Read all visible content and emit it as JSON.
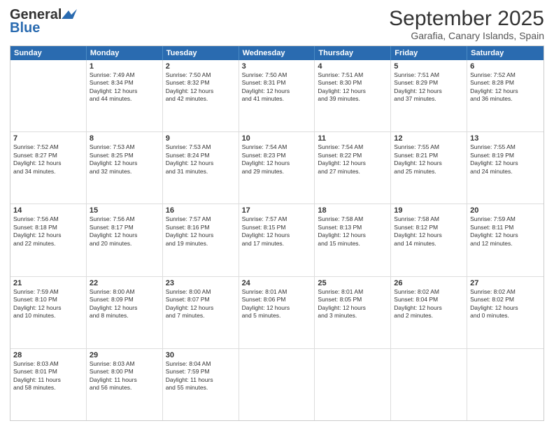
{
  "header": {
    "logo_general": "General",
    "logo_blue": "Blue",
    "title": "September 2025",
    "subtitle": "Garafia, Canary Islands, Spain"
  },
  "days_of_week": [
    "Sunday",
    "Monday",
    "Tuesday",
    "Wednesday",
    "Thursday",
    "Friday",
    "Saturday"
  ],
  "weeks": [
    [
      {
        "day": "",
        "info": ""
      },
      {
        "day": "1",
        "info": "Sunrise: 7:49 AM\nSunset: 8:34 PM\nDaylight: 12 hours\nand 44 minutes."
      },
      {
        "day": "2",
        "info": "Sunrise: 7:50 AM\nSunset: 8:32 PM\nDaylight: 12 hours\nand 42 minutes."
      },
      {
        "day": "3",
        "info": "Sunrise: 7:50 AM\nSunset: 8:31 PM\nDaylight: 12 hours\nand 41 minutes."
      },
      {
        "day": "4",
        "info": "Sunrise: 7:51 AM\nSunset: 8:30 PM\nDaylight: 12 hours\nand 39 minutes."
      },
      {
        "day": "5",
        "info": "Sunrise: 7:51 AM\nSunset: 8:29 PM\nDaylight: 12 hours\nand 37 minutes."
      },
      {
        "day": "6",
        "info": "Sunrise: 7:52 AM\nSunset: 8:28 PM\nDaylight: 12 hours\nand 36 minutes."
      }
    ],
    [
      {
        "day": "7",
        "info": "Sunrise: 7:52 AM\nSunset: 8:27 PM\nDaylight: 12 hours\nand 34 minutes."
      },
      {
        "day": "8",
        "info": "Sunrise: 7:53 AM\nSunset: 8:25 PM\nDaylight: 12 hours\nand 32 minutes."
      },
      {
        "day": "9",
        "info": "Sunrise: 7:53 AM\nSunset: 8:24 PM\nDaylight: 12 hours\nand 31 minutes."
      },
      {
        "day": "10",
        "info": "Sunrise: 7:54 AM\nSunset: 8:23 PM\nDaylight: 12 hours\nand 29 minutes."
      },
      {
        "day": "11",
        "info": "Sunrise: 7:54 AM\nSunset: 8:22 PM\nDaylight: 12 hours\nand 27 minutes."
      },
      {
        "day": "12",
        "info": "Sunrise: 7:55 AM\nSunset: 8:21 PM\nDaylight: 12 hours\nand 25 minutes."
      },
      {
        "day": "13",
        "info": "Sunrise: 7:55 AM\nSunset: 8:19 PM\nDaylight: 12 hours\nand 24 minutes."
      }
    ],
    [
      {
        "day": "14",
        "info": "Sunrise: 7:56 AM\nSunset: 8:18 PM\nDaylight: 12 hours\nand 22 minutes."
      },
      {
        "day": "15",
        "info": "Sunrise: 7:56 AM\nSunset: 8:17 PM\nDaylight: 12 hours\nand 20 minutes."
      },
      {
        "day": "16",
        "info": "Sunrise: 7:57 AM\nSunset: 8:16 PM\nDaylight: 12 hours\nand 19 minutes."
      },
      {
        "day": "17",
        "info": "Sunrise: 7:57 AM\nSunset: 8:15 PM\nDaylight: 12 hours\nand 17 minutes."
      },
      {
        "day": "18",
        "info": "Sunrise: 7:58 AM\nSunset: 8:13 PM\nDaylight: 12 hours\nand 15 minutes."
      },
      {
        "day": "19",
        "info": "Sunrise: 7:58 AM\nSunset: 8:12 PM\nDaylight: 12 hours\nand 14 minutes."
      },
      {
        "day": "20",
        "info": "Sunrise: 7:59 AM\nSunset: 8:11 PM\nDaylight: 12 hours\nand 12 minutes."
      }
    ],
    [
      {
        "day": "21",
        "info": "Sunrise: 7:59 AM\nSunset: 8:10 PM\nDaylight: 12 hours\nand 10 minutes."
      },
      {
        "day": "22",
        "info": "Sunrise: 8:00 AM\nSunset: 8:09 PM\nDaylight: 12 hours\nand 8 minutes."
      },
      {
        "day": "23",
        "info": "Sunrise: 8:00 AM\nSunset: 8:07 PM\nDaylight: 12 hours\nand 7 minutes."
      },
      {
        "day": "24",
        "info": "Sunrise: 8:01 AM\nSunset: 8:06 PM\nDaylight: 12 hours\nand 5 minutes."
      },
      {
        "day": "25",
        "info": "Sunrise: 8:01 AM\nSunset: 8:05 PM\nDaylight: 12 hours\nand 3 minutes."
      },
      {
        "day": "26",
        "info": "Sunrise: 8:02 AM\nSunset: 8:04 PM\nDaylight: 12 hours\nand 2 minutes."
      },
      {
        "day": "27",
        "info": "Sunrise: 8:02 AM\nSunset: 8:02 PM\nDaylight: 12 hours\nand 0 minutes."
      }
    ],
    [
      {
        "day": "28",
        "info": "Sunrise: 8:03 AM\nSunset: 8:01 PM\nDaylight: 11 hours\nand 58 minutes."
      },
      {
        "day": "29",
        "info": "Sunrise: 8:03 AM\nSunset: 8:00 PM\nDaylight: 11 hours\nand 56 minutes."
      },
      {
        "day": "30",
        "info": "Sunrise: 8:04 AM\nSunset: 7:59 PM\nDaylight: 11 hours\nand 55 minutes."
      },
      {
        "day": "",
        "info": ""
      },
      {
        "day": "",
        "info": ""
      },
      {
        "day": "",
        "info": ""
      },
      {
        "day": "",
        "info": ""
      }
    ]
  ]
}
